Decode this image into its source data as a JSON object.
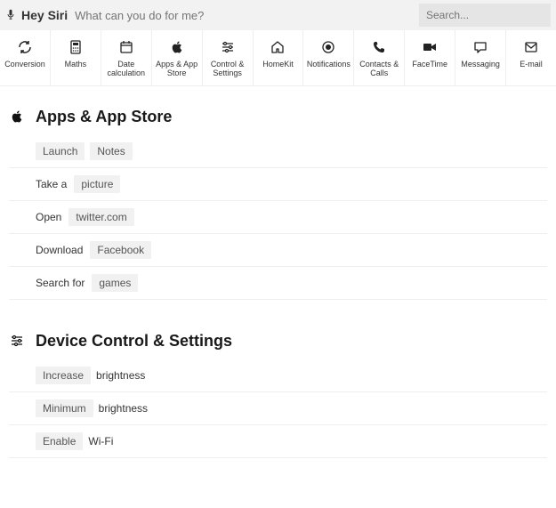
{
  "topbar": {
    "hey_siri": "Hey Siri",
    "prompt_placeholder": "What can you do for me?",
    "search_placeholder": "Search..."
  },
  "nav": [
    {
      "icon": "refresh-icon",
      "label": "Conversion"
    },
    {
      "icon": "calculator-icon",
      "label": "Maths"
    },
    {
      "icon": "calendar-icon",
      "label": "Date calculation"
    },
    {
      "icon": "apple-icon",
      "label": "Apps & App Store"
    },
    {
      "icon": "sliders-icon",
      "label": "Control & Settings"
    },
    {
      "icon": "home-icon",
      "label": "HomeKit"
    },
    {
      "icon": "circle-dot-icon",
      "label": "Notifications"
    },
    {
      "icon": "phone-icon",
      "label": "Contacts & Calls"
    },
    {
      "icon": "video-icon",
      "label": "FaceTime"
    },
    {
      "icon": "chat-icon",
      "label": "Messaging"
    },
    {
      "icon": "mail-icon",
      "label": "E-mail"
    }
  ],
  "sections": [
    {
      "icon": "apple-icon",
      "title": "Apps & App Store",
      "rows": [
        [
          {
            "t": "para",
            "v": "Launch"
          },
          {
            "t": "para",
            "v": "Notes"
          }
        ],
        [
          {
            "t": "plain",
            "v": "Take a"
          },
          {
            "t": "para",
            "v": "picture"
          }
        ],
        [
          {
            "t": "plain",
            "v": "Open"
          },
          {
            "t": "para",
            "v": "twitter.com"
          }
        ],
        [
          {
            "t": "plain",
            "v": "Download"
          },
          {
            "t": "para",
            "v": "Facebook"
          }
        ],
        [
          {
            "t": "plain",
            "v": "Search for"
          },
          {
            "t": "para",
            "v": "games"
          }
        ]
      ]
    },
    {
      "icon": "sliders-icon",
      "title": "Device Control & Settings",
      "rows": [
        [
          {
            "t": "para",
            "v": "Increase"
          },
          {
            "t": "plain",
            "v": "brightness"
          }
        ],
        [
          {
            "t": "para",
            "v": "Minimum"
          },
          {
            "t": "plain",
            "v": "brightness"
          }
        ],
        [
          {
            "t": "para",
            "v": "Enable"
          },
          {
            "t": "plain",
            "v": "Wi-Fi"
          }
        ]
      ]
    }
  ]
}
